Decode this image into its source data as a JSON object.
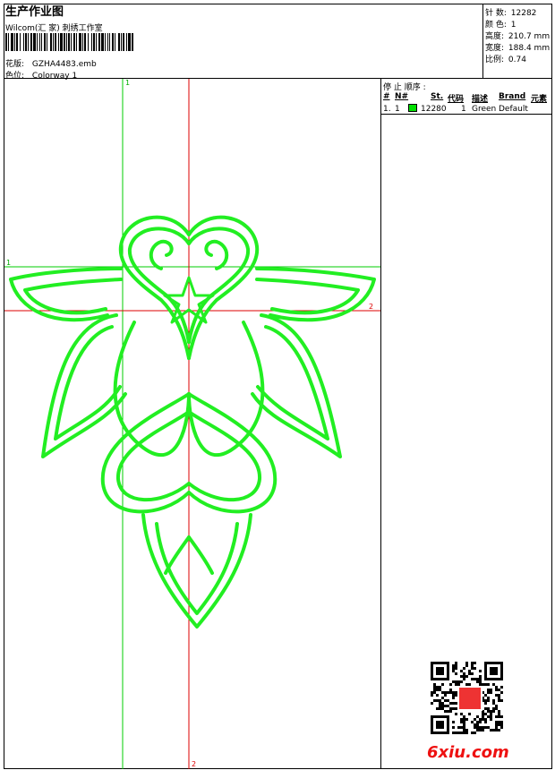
{
  "header": {
    "title": "生产作业图",
    "studio": "Wilcom(汇 家) 刺绣工作室",
    "pattern_label": "花版:",
    "pattern_value": "GZHA4483.emb",
    "colorway_label": "色位:",
    "colorway_value": "Colorway 1"
  },
  "stats": {
    "stitches_label": "针 数:",
    "stitches_value": "12282",
    "colors_label": "颜 色:",
    "colors_value": "1",
    "height_label": "高度:",
    "height_value": "210.7 mm",
    "width_label": "宽度:",
    "width_value": "188.4 mm",
    "scale_label": "比例:",
    "scale_value": "0.74"
  },
  "stop_sequence": {
    "title": "停 止 顺序 :",
    "columns": [
      "#",
      "N#",
      "St.",
      "代码",
      "描述",
      "Brand",
      "元素"
    ],
    "rows": [
      {
        "index": "1.",
        "needle": "1",
        "code": "12280",
        "st": "1",
        "desc": "Green",
        "brand": "Default",
        "color": "#00e000"
      }
    ]
  },
  "guides": {
    "v_green_label": "1",
    "h_green_label": "1",
    "h_red_label": "2",
    "v_red_label": "2"
  },
  "colors": {
    "stitch_green": "#22ee22",
    "guide_green": "#00cc00",
    "guide_red": "#dd0000"
  },
  "watermark": "6xiu.com"
}
